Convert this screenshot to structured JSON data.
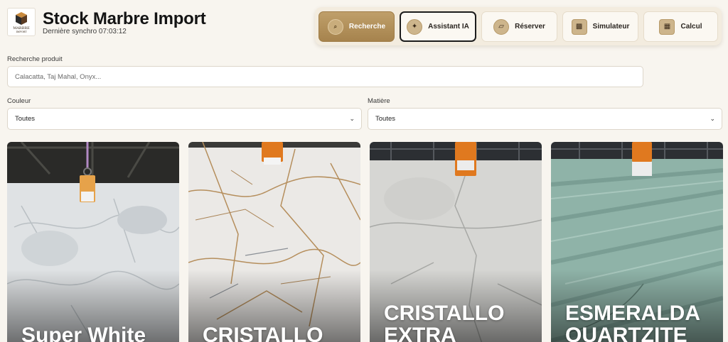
{
  "header": {
    "title": "Stock Marbre Import",
    "sync": "Dernière synchro 07:03:12",
    "logo": {
      "line1": "MARBRE",
      "line2": "IMPORT"
    }
  },
  "toolbar": {
    "buttons": [
      {
        "label": "Recherche",
        "icon": "search-icon"
      },
      {
        "label": "Assistant IA",
        "icon": "sparkle-icon"
      },
      {
        "label": "Réserver",
        "icon": "tag-icon"
      },
      {
        "label": "Simulateur",
        "icon": "square-icon"
      },
      {
        "label": "Calcul",
        "icon": "calculator-icon"
      }
    ]
  },
  "search": {
    "label": "Recherche produit",
    "placeholder": "Calacatta, Taj Mahal, Onyx..."
  },
  "filters": {
    "color": {
      "label": "Couleur",
      "value": "Toutes"
    },
    "material": {
      "label": "Matière",
      "value": "Toutes"
    }
  },
  "products": [
    {
      "name": "Super White"
    },
    {
      "name": "CRISTALLO"
    },
    {
      "name": "CRISTALLO EXTRA"
    },
    {
      "name": "ESMERALDA QUARTZITE"
    }
  ],
  "colors": {
    "accent": "#b08f5b",
    "background": "#f8f5ef"
  }
}
